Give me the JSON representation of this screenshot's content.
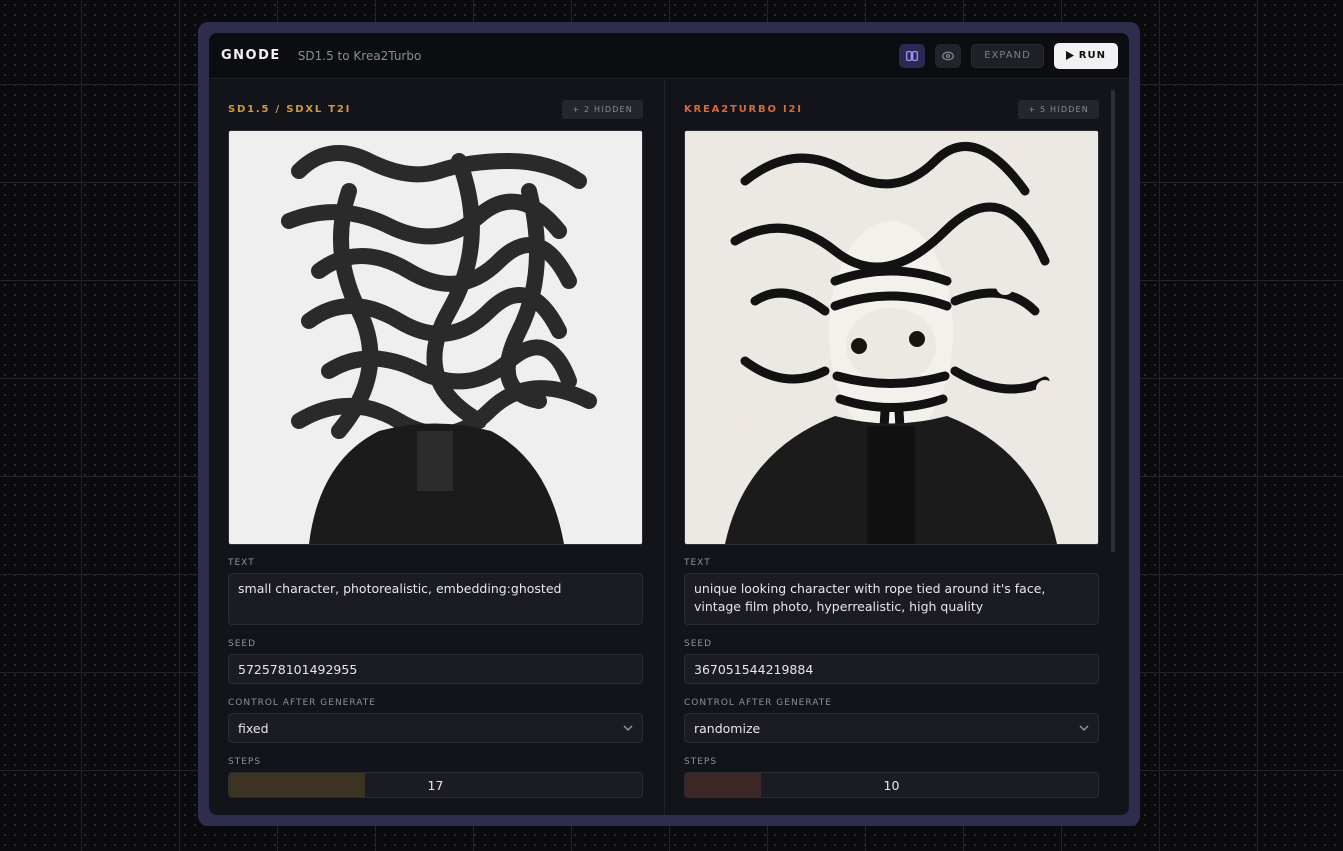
{
  "header": {
    "brand": "GNODE",
    "subtitle": "SD1.5 to Krea2Turbo",
    "expand_label": "EXPAND",
    "run_label": "RUN",
    "icons": [
      "split-view-icon",
      "eye-icon",
      "play-icon"
    ]
  },
  "left": {
    "title": "SD1.5 / SDXL T2I",
    "title_color": "#d29a3d",
    "hidden": "+ 2 HIDDEN",
    "text_label": "TEXT",
    "text_value": "small character, photorealistic, embedding:ghosted",
    "seed_label": "SEED",
    "seed_value": "572578101492955",
    "control_label": "CONTROL AFTER GENERATE",
    "control_value": "fixed",
    "steps_label": "STEPS",
    "steps_value": "17",
    "steps_fraction": 0.33,
    "steps_color": "#3d3323"
  },
  "right": {
    "title": "KREA2TURBO I2I",
    "title_color": "#d66a3e",
    "hidden": "+ 5 HIDDEN",
    "text_label": "TEXT",
    "text_value": "unique looking character with rope tied around it's face, vintage film photo, hyperrealistic, high quality",
    "seed_label": "SEED",
    "seed_value": "367051544219884",
    "control_label": "CONTROL AFTER GENERATE",
    "control_value": "randomize",
    "steps_label": "STEPS",
    "steps_value": "10",
    "steps_fraction": 0.185,
    "steps_color": "#3d2726"
  },
  "colors": {
    "accent_purple": "#2b2a55",
    "frame": "#2e2d4e"
  }
}
